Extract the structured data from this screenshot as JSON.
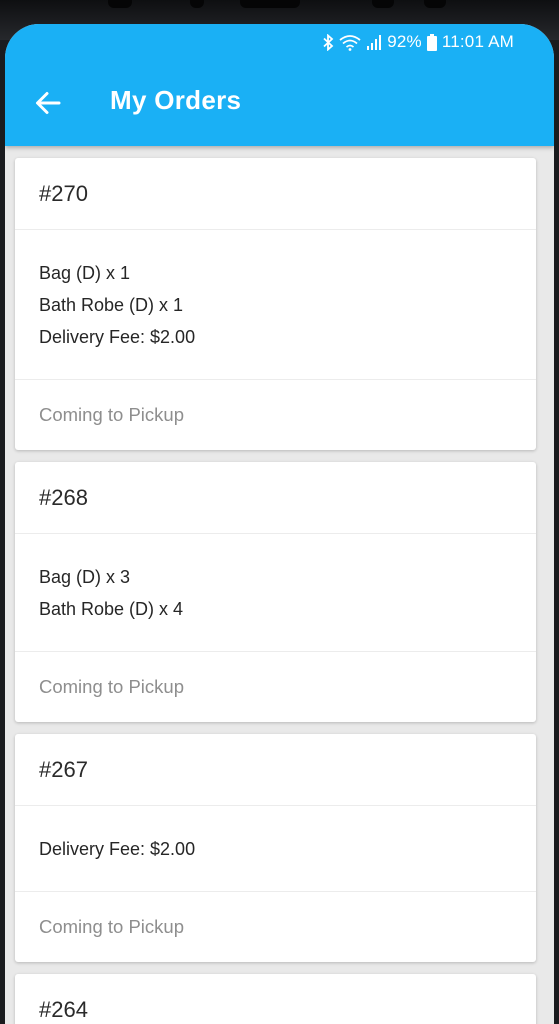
{
  "status_bar": {
    "battery": "92%",
    "time": "11:01 AM",
    "icons": [
      "bluetooth-icon",
      "wifi-icon",
      "signal-icon",
      "battery-icon"
    ]
  },
  "app_bar": {
    "title": "My Orders",
    "back_icon": "arrow-back-icon",
    "color": "#1ab0f5"
  },
  "orders": [
    {
      "number": "#270",
      "items": [
        "Bag (D) x 1",
        "Bath Robe (D) x 1",
        "Delivery Fee: $2.00"
      ],
      "status": "Coming to Pickup"
    },
    {
      "number": "#268",
      "items": [
        "Bag (D) x 3",
        "Bath Robe (D) x 4"
      ],
      "status": "Coming to Pickup"
    },
    {
      "number": "#267",
      "items": [
        "Delivery Fee: $2.00"
      ],
      "status": "Coming to Pickup"
    },
    {
      "number": "#264",
      "items": [],
      "status": ""
    }
  ]
}
